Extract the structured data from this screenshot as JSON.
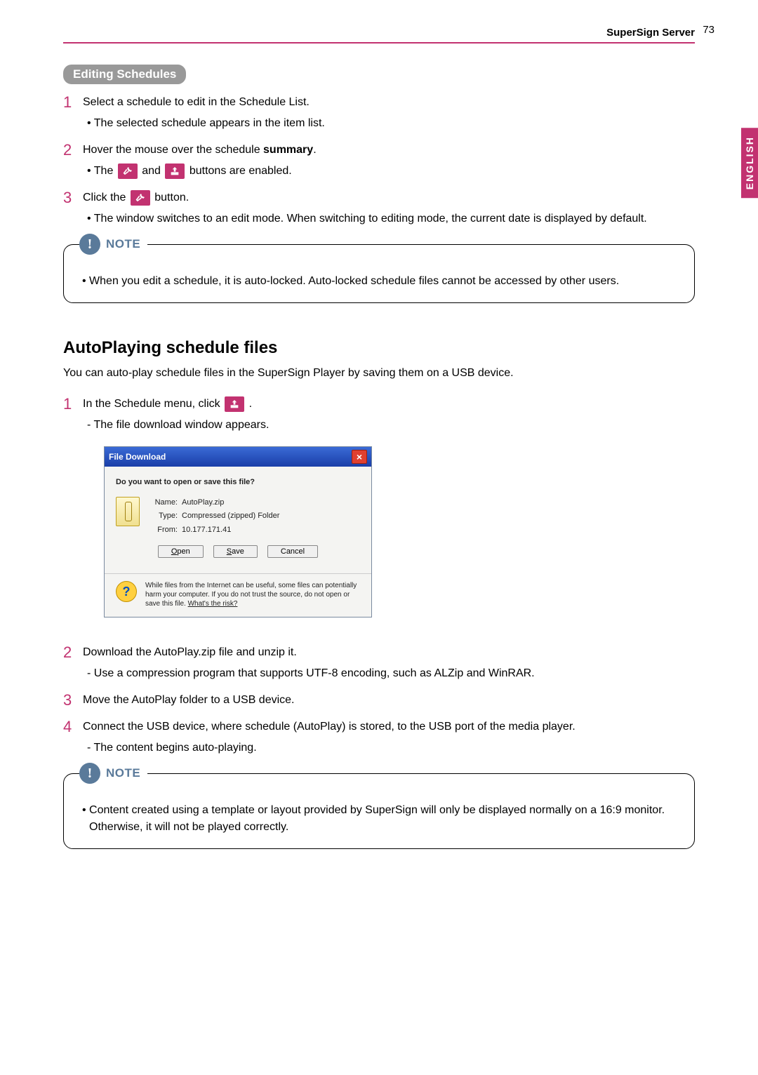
{
  "header": {
    "title": "SuperSign Server",
    "page_number": "73",
    "language_tab": "ENGLISH"
  },
  "section_editing": {
    "title": "Editing Schedules",
    "steps": [
      {
        "text": "Select a schedule to edit in the Schedule List.",
        "bullets": [
          "The selected schedule appears in the item list."
        ]
      },
      {
        "text_pre": "Hover the mouse over the schedule ",
        "text_bold": "summary",
        "text_post": ".",
        "bullets_pre": "The ",
        "bullets_mid": " and ",
        "bullets_post": " buttons are enabled."
      },
      {
        "text_pre": "Click the ",
        "text_post": " button.",
        "bullets": [
          "The window switches to an edit mode. When switching to editing mode, the current date is displayed by default."
        ]
      }
    ]
  },
  "note1": {
    "label": "NOTE",
    "text": "When you edit a schedule, it is auto-locked. Auto-locked schedule files cannot be accessed by other users."
  },
  "section_autoplay": {
    "title": "AutoPlaying schedule files",
    "intro": "You can auto-play schedule files in the SuperSign Player by saving them on a USB device.",
    "step1_pre": "In the Schedule menu, click ",
    "step1_post": " .",
    "step1_dash": [
      "The file download window appears."
    ],
    "step2": "Download the AutoPlay.zip file and unzip it.",
    "step2_dash": [
      "Use a compression program that supports UTF-8 encoding, such as ALZip and WinRAR."
    ],
    "step3": "Move the AutoPlay folder to a USB device.",
    "step4": "Connect the USB device, where schedule (AutoPlay) is stored, to the USB port of the media player.",
    "step4_dash": [
      "The content begins auto-playing."
    ]
  },
  "dialog": {
    "title": "File Download",
    "question": "Do you want to open or save this file?",
    "name_label": "Name:",
    "name_value": "AutoPlay.zip",
    "type_label": "Type:",
    "type_value": "Compressed (zipped) Folder",
    "from_label": "From:",
    "from_value": "10.177.171.41",
    "btn_open": "Open",
    "btn_save": "Save",
    "btn_cancel": "Cancel",
    "warning": "While files from the Internet can be useful, some files can potentially harm your computer. If you do not trust the source, do not open or save this file. ",
    "risk_link": "What's the risk?"
  },
  "note2": {
    "label": "NOTE",
    "text": "Content created using a template or layout provided by SuperSign will only be displayed normally on a 16:9 monitor. Otherwise, it will not be played correctly."
  }
}
